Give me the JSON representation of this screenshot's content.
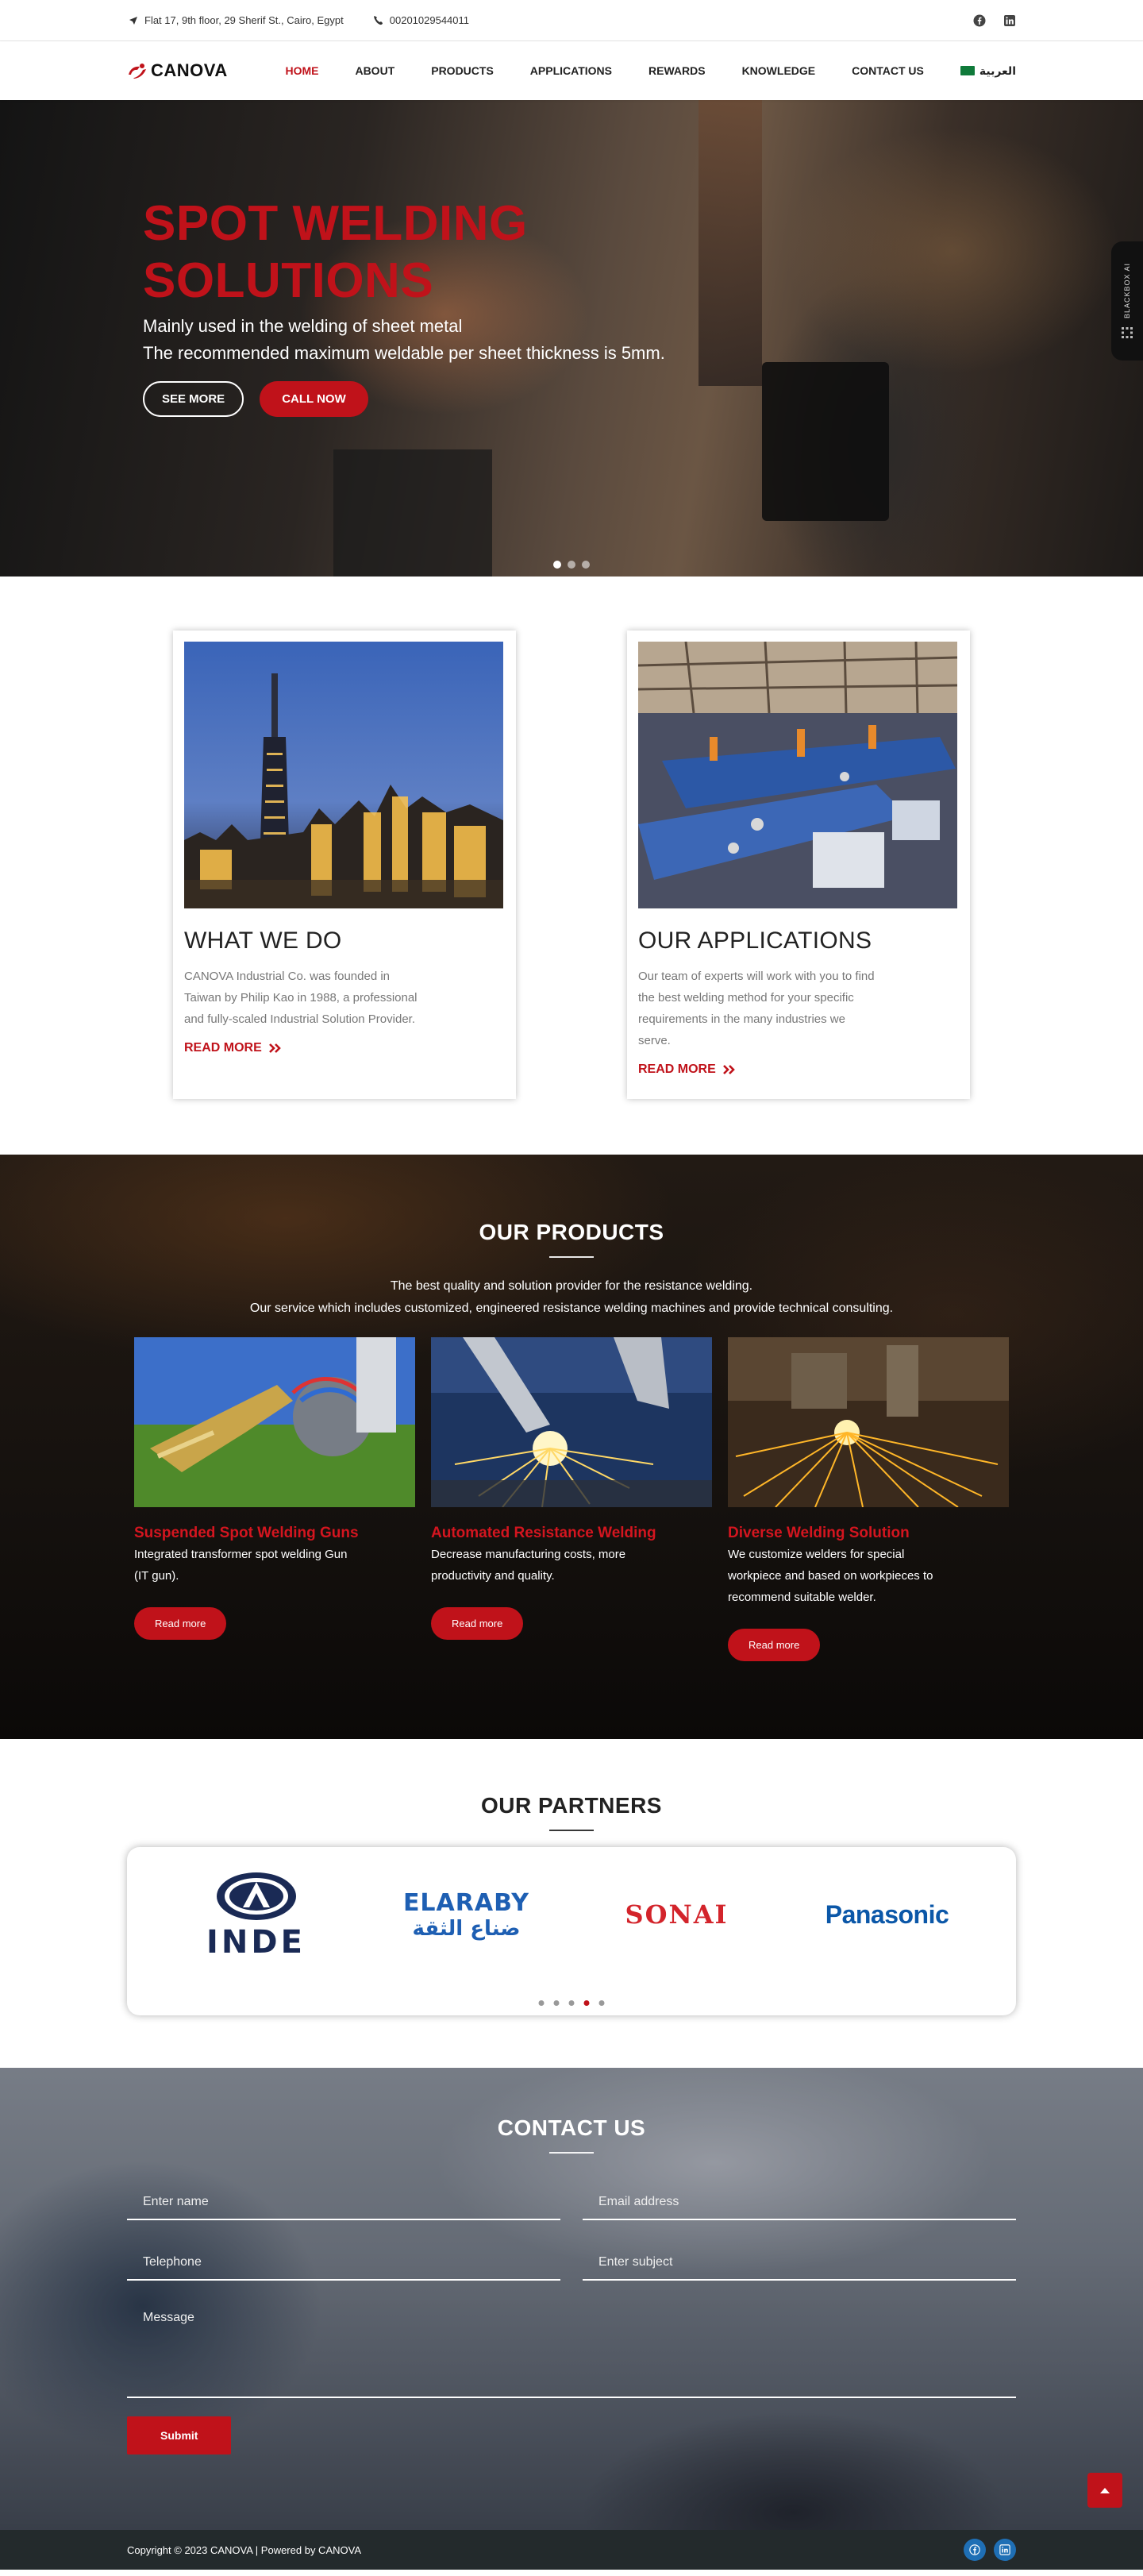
{
  "topbar": {
    "address": "Flat 17, 9th floor, 29 Sherif St., Cairo, Egypt",
    "phone": "00201029544011"
  },
  "nav": {
    "brand": "CANOVA",
    "items": [
      "HOME",
      "ABOUT",
      "PRODUCTS",
      "APPLICATIONS",
      "REWARDS",
      "KNOWLEDGE",
      "CONTACT US"
    ],
    "language": "العربية"
  },
  "hero": {
    "title": "SPOT WELDING SOLUTIONS",
    "line1": "Mainly used in the welding of sheet metal",
    "line2": "The recommended maximum weldable per sheet thickness is 5mm.",
    "see_more": "SEE MORE",
    "call_now": "CALL NOW",
    "widget_label": "BLACKBOX AI"
  },
  "cards": [
    {
      "title": "WHAT WE DO",
      "text": "CANOVA Industrial Co. was founded in Taiwan by Philip Kao in 1988, a professional and fully-scaled Industrial Solution Provider.",
      "link": "READ MORE"
    },
    {
      "title": "OUR APPLICATIONS",
      "text": "Our team of experts will work with you to find the best welding method for your specific requirements in the many industries we serve.",
      "link": "READ MORE"
    }
  ],
  "products": {
    "title": "OUR PRODUCTS",
    "lead1": "The best quality and solution provider for the resistance welding.",
    "lead2": "Our service which includes customized, engineered resistance welding machines and provide technical consulting.",
    "items": [
      {
        "title": "Suspended Spot Welding Guns",
        "text": "Integrated transformer spot welding Gun (IT gun).",
        "button": "Read more"
      },
      {
        "title": "Automated Resistance Welding",
        "text": "Decrease manufacturing costs, more productivity and quality.",
        "button": "Read more"
      },
      {
        "title": "Diverse Welding Solution",
        "text": "We customize welders for special workpiece and based on workpieces to recommend suitable welder.",
        "button": "Read more"
      }
    ]
  },
  "partners": {
    "title": "OUR PARTNERS",
    "logos": [
      "INDE",
      "ELARABY",
      "ضناع الثقة",
      "SONAI",
      "Panasonic"
    ]
  },
  "contact": {
    "title": "CONTACT US",
    "name_placeholder": "Enter name",
    "email_placeholder": "Email address",
    "phone_placeholder": "Telephone",
    "subject_placeholder": "Enter subject",
    "message_placeholder": "Message",
    "submit": "Submit"
  },
  "footer": {
    "copyright": "Copyright © 2023 CANOVA | Powered by CANOVA"
  },
  "colors": {
    "brand_red": "#c0121a",
    "footer_bg": "#232a2c",
    "social_blue": "#1f6fb5"
  }
}
